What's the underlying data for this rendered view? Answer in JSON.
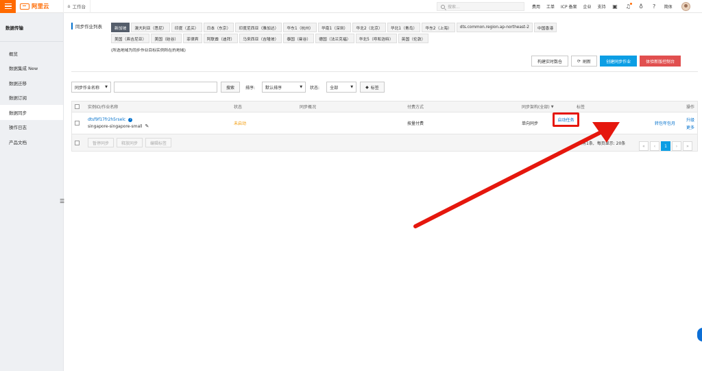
{
  "topbar": {
    "logo_text": "阿里云",
    "workbench": "工作台",
    "search_placeholder": "搜索...",
    "nav": [
      "费用",
      "工单",
      "ICP 备案",
      "企业",
      "支持"
    ],
    "lang": "简体"
  },
  "sidebar": {
    "title": "数据传输",
    "items": [
      "概览",
      "数据集成 New",
      "数据迁移",
      "数据订阅",
      "数据同步",
      "操作日志",
      "产品文档"
    ],
    "active_index": 4
  },
  "region": {
    "label": "同步作业列表",
    "row1": [
      "新加坡",
      "澳大利亚（悉尼）",
      "印度（孟买）",
      "日本（东京）",
      "印度尼西亚（雅加达）",
      "华东1（杭州）",
      "华南1（深圳）",
      "华北2（北京）",
      "华北1（青岛）",
      "华东2（上海）",
      "dts.common.region.ap-northeast-2",
      "中国香港"
    ],
    "row2": [
      "美国（弗吉尼亚）",
      "美国（硅谷）",
      "菲律宾",
      "阿联酋（迪拜）",
      "马来西亚（吉隆坡）",
      "泰国（曼谷）",
      "德国（法兰克福）",
      "华北5（呼和浩特）",
      "英国（伦敦）"
    ],
    "active": "新加坡",
    "note": "(所选地域为同步作业目标实例所在的地域)"
  },
  "actions": {
    "build": "构建实时数仓",
    "refresh": "刷新",
    "create": "创建同步作业",
    "new_console": "体验新版控制台"
  },
  "filter": {
    "field_select": "同步作业名称",
    "search_btn": "搜索",
    "sort_label": "排序:",
    "sort_value": "默认排序",
    "status_label": "状态:",
    "status_value": "全部",
    "tag_btn": "标签"
  },
  "table": {
    "headers": {
      "instance": "实例ID/作业名称",
      "status": "状态",
      "overview": "同步概况",
      "pay": "付费方式",
      "arch": "同步架构(全部)",
      "tag": "标签",
      "ops": "操作"
    },
    "row": {
      "id": "dtsf9f17fr2h5rselc",
      "name": "singapore-singapore-small",
      "status": "未启动",
      "pay": "按量付费",
      "arch": "单向同步",
      "op_start": "启动任务",
      "op_convert": "转包年包月",
      "op_upgrade": "升级",
      "op_more": "更多"
    },
    "footer": {
      "pause": "暂停同步",
      "release": "释放同步",
      "edit_tag": "编辑标签",
      "total": "共有1条,",
      "page_size": "每页显示: 20条",
      "current_page": "1"
    }
  },
  "colors": {
    "brand": "#ff6a00",
    "link": "#0070cc",
    "primary": "#0c9ee4",
    "danger": "#e14f4f",
    "arrow": "#e5170d"
  }
}
